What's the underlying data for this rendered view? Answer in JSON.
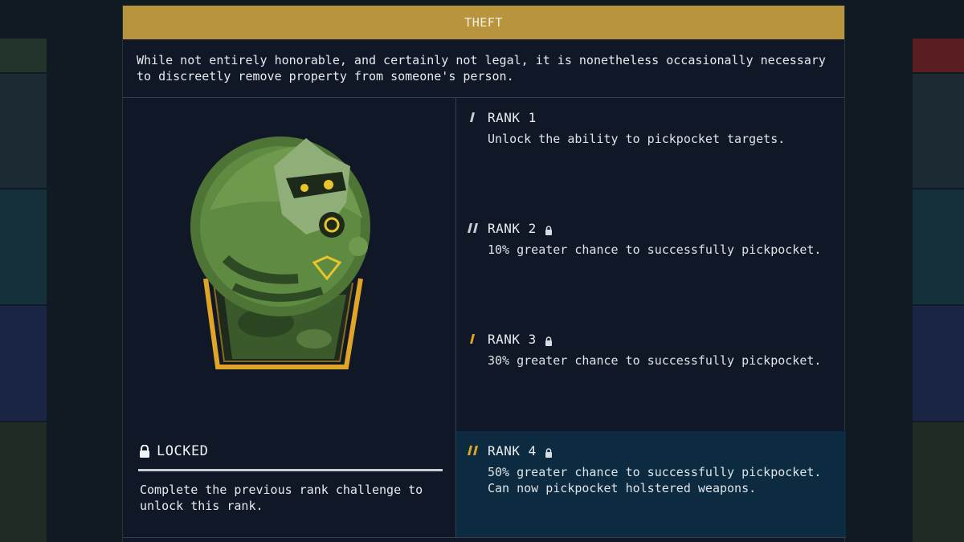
{
  "perk": {
    "title": "THEFT",
    "description": "While not entirely honorable, and certainly not legal, it is nonetheless occasionally necessary to discreetly remove property from someone's person."
  },
  "status": {
    "label": "LOCKED",
    "requirement": "Complete the previous rank challenge to unlock this rank."
  },
  "ranks": [
    {
      "title": "RANK 1",
      "description": "Unlock the ability to pickpocket targets.",
      "locked": false,
      "icon_color": "#c9ced3"
    },
    {
      "title": "RANK 2",
      "description": "10% greater chance to successfully pickpocket.",
      "locked": true,
      "icon_color": "#c9ced3"
    },
    {
      "title": "RANK 3",
      "description": "30% greater chance to successfully pickpocket.",
      "locked": true,
      "icon_color": "#e0a526"
    },
    {
      "title": "RANK 4",
      "description": "50% greater chance to successfully pickpocket. Can now pickpocket holstered weapons.",
      "locked": true,
      "icon_color": "#e0a526"
    }
  ],
  "icons": {
    "patch": "raccoon-patch-icon",
    "lock": "lock-icon",
    "rank": "rank-tally-icon"
  },
  "colors": {
    "header": "#b8953c",
    "active_rank_bg": "#0d2b40",
    "panel_bg": "#101827",
    "gold": "#e0a526"
  }
}
